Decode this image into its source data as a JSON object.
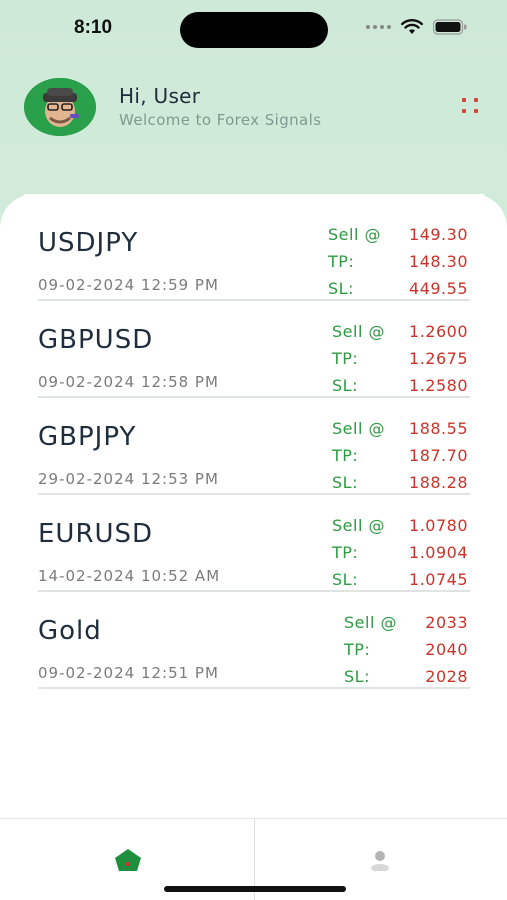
{
  "status_bar": {
    "time": "8:10"
  },
  "header": {
    "greeting": "Hi, User",
    "subtitle": "Welcome to Forex Signals"
  },
  "signals": [
    {
      "pair": "USDJPY",
      "date": "09-02-2024 12:59 PM",
      "action_label": "Sell @",
      "entry": "149.30",
      "tp_label": "TP:",
      "tp": "148.30",
      "sl_label": "SL:",
      "sl": "449.55"
    },
    {
      "pair": "GBPUSD",
      "date": "09-02-2024 12:58 PM",
      "action_label": "Sell @",
      "entry": "1.2600",
      "tp_label": "TP:",
      "tp": "1.2675",
      "sl_label": "SL:",
      "sl": "1.2580"
    },
    {
      "pair": "GBPJPY",
      "date": "29-02-2024 12:53 PM",
      "action_label": "Sell @",
      "entry": "188.55",
      "tp_label": "TP:",
      "tp": "187.70",
      "sl_label": "SL:",
      "sl": "188.28"
    },
    {
      "pair": "EURUSD",
      "date": "14-02-2024 10:52 AM",
      "action_label": "Sell @",
      "entry": "1.0780",
      "tp_label": "TP:",
      "tp": "1.0904",
      "sl_label": "SL:",
      "sl": "1.0745"
    },
    {
      "pair": "Gold",
      "date": "09-02-2024 12:51 PM",
      "action_label": "Sell @",
      "entry": "2033",
      "tp_label": "TP:",
      "tp": "2040",
      "sl_label": "SL:",
      "sl": "2028"
    }
  ],
  "tabs": [
    {
      "name": "home",
      "icon": "home-icon",
      "active": true
    },
    {
      "name": "profile",
      "icon": "user-icon",
      "active": false
    }
  ],
  "colors": {
    "accent_green": "#2f9a43",
    "value_red": "#c9342a",
    "menu_red": "#d0473a"
  }
}
